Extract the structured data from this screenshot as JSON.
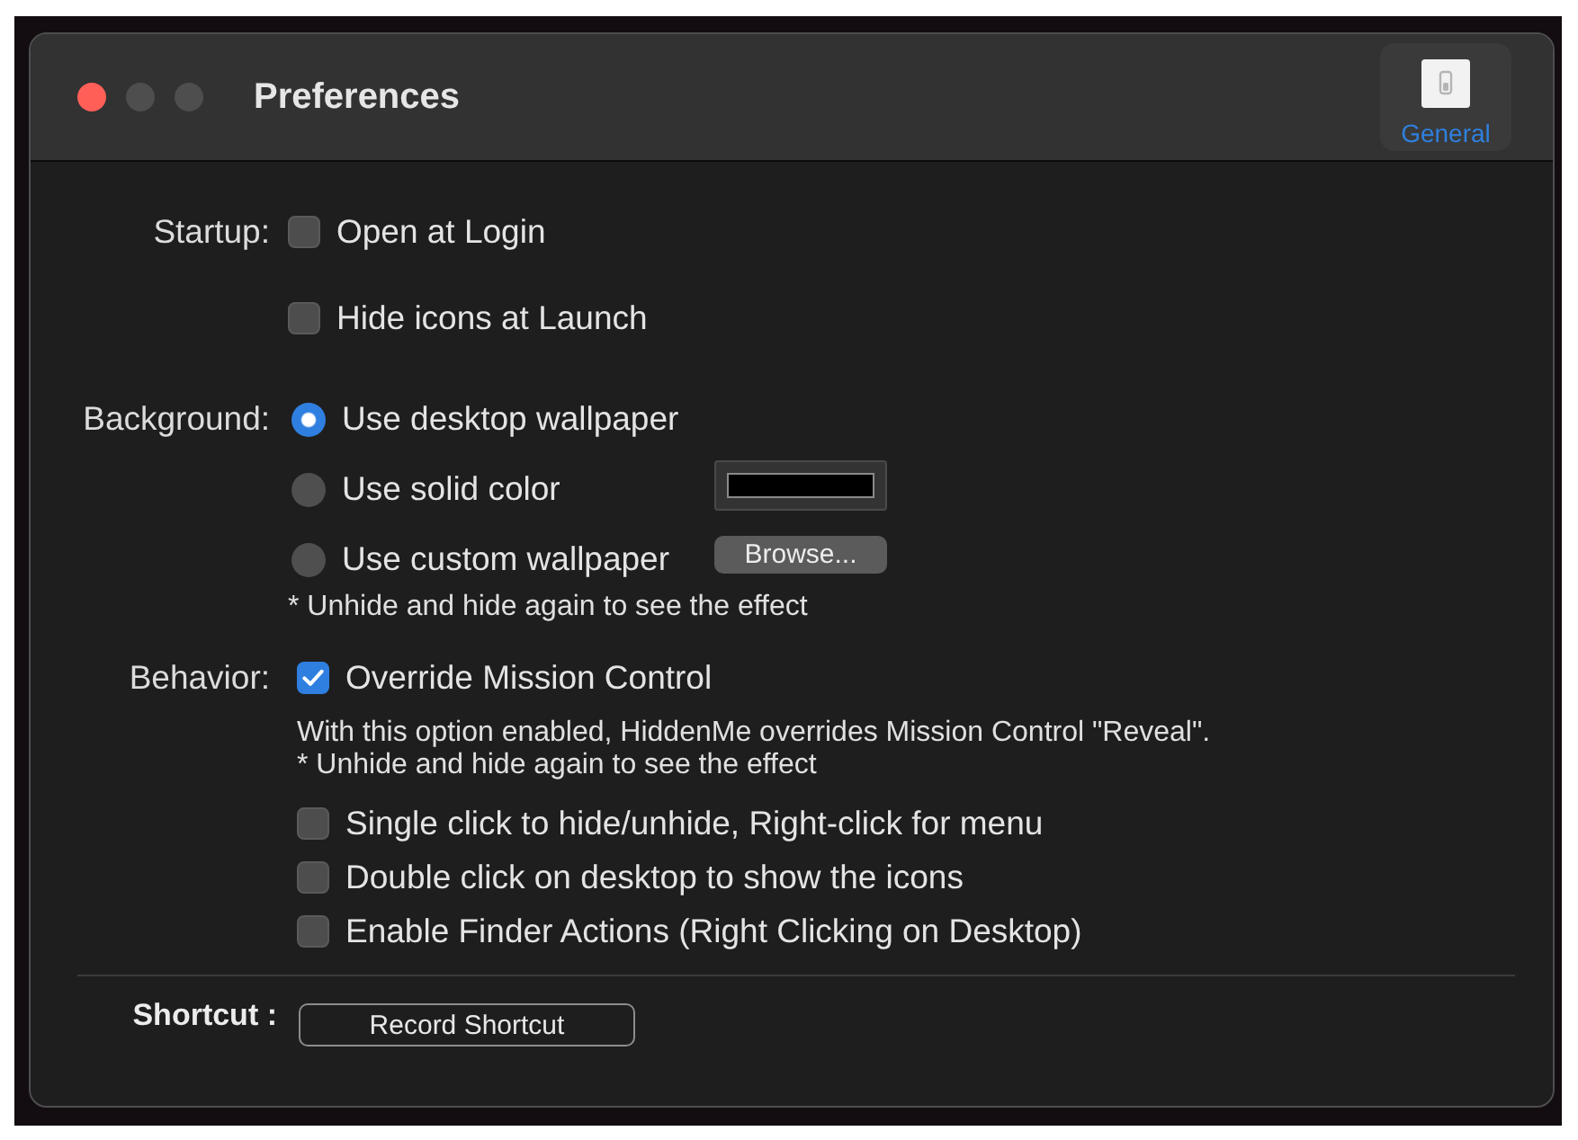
{
  "window": {
    "title": "Preferences",
    "buttons": [
      {
        "kind": "close",
        "disabled": false
      },
      {
        "kind": "minimize",
        "disabled": true
      },
      {
        "kind": "zoom",
        "disabled": true
      }
    ]
  },
  "toolbar": [
    {
      "label": "General",
      "selected": true
    }
  ],
  "sections": [
    {
      "label": "Startup:",
      "rows": [
        {
          "kind": "checkbox",
          "label": "Open at Login",
          "checked": false
        },
        {
          "kind": "checkbox",
          "label": "Hide icons at Launch",
          "checked": false
        }
      ]
    },
    {
      "label": "Background:",
      "rows": [
        {
          "kind": "radio",
          "label": "Use desktop wallpaper",
          "selected": true
        },
        {
          "kind": "radio",
          "label": "Use solid color",
          "selected": false,
          "accessory": {
            "kind": "color_well",
            "color": "#000000"
          }
        },
        {
          "kind": "radio",
          "label": "Use custom wallpaper",
          "selected": false,
          "accessory": {
            "kind": "button",
            "label": "Browse..."
          }
        },
        {
          "kind": "note",
          "text": "* Unhide and hide again to see the effect"
        }
      ]
    },
    {
      "label": "Behavior:",
      "rows": [
        {
          "kind": "checkbox",
          "label": "Override Mission Control",
          "checked": true
        },
        {
          "kind": "note",
          "text": "With this option enabled, HiddenMe overrides Mission Control \"Reveal\"."
        },
        {
          "kind": "note",
          "text": "* Unhide and hide again to see the effect"
        },
        {
          "kind": "checkbox",
          "label": "Single click to hide/unhide, Right-click for menu",
          "checked": false
        },
        {
          "kind": "checkbox",
          "label": "Double click on desktop to show the icons",
          "checked": false
        },
        {
          "kind": "checkbox",
          "label": "Enable Finder Actions (Right Clicking on Desktop)",
          "checked": false
        }
      ]
    }
  ],
  "shortcut": {
    "label": "Shortcut :",
    "button": "Record Shortcut"
  }
}
